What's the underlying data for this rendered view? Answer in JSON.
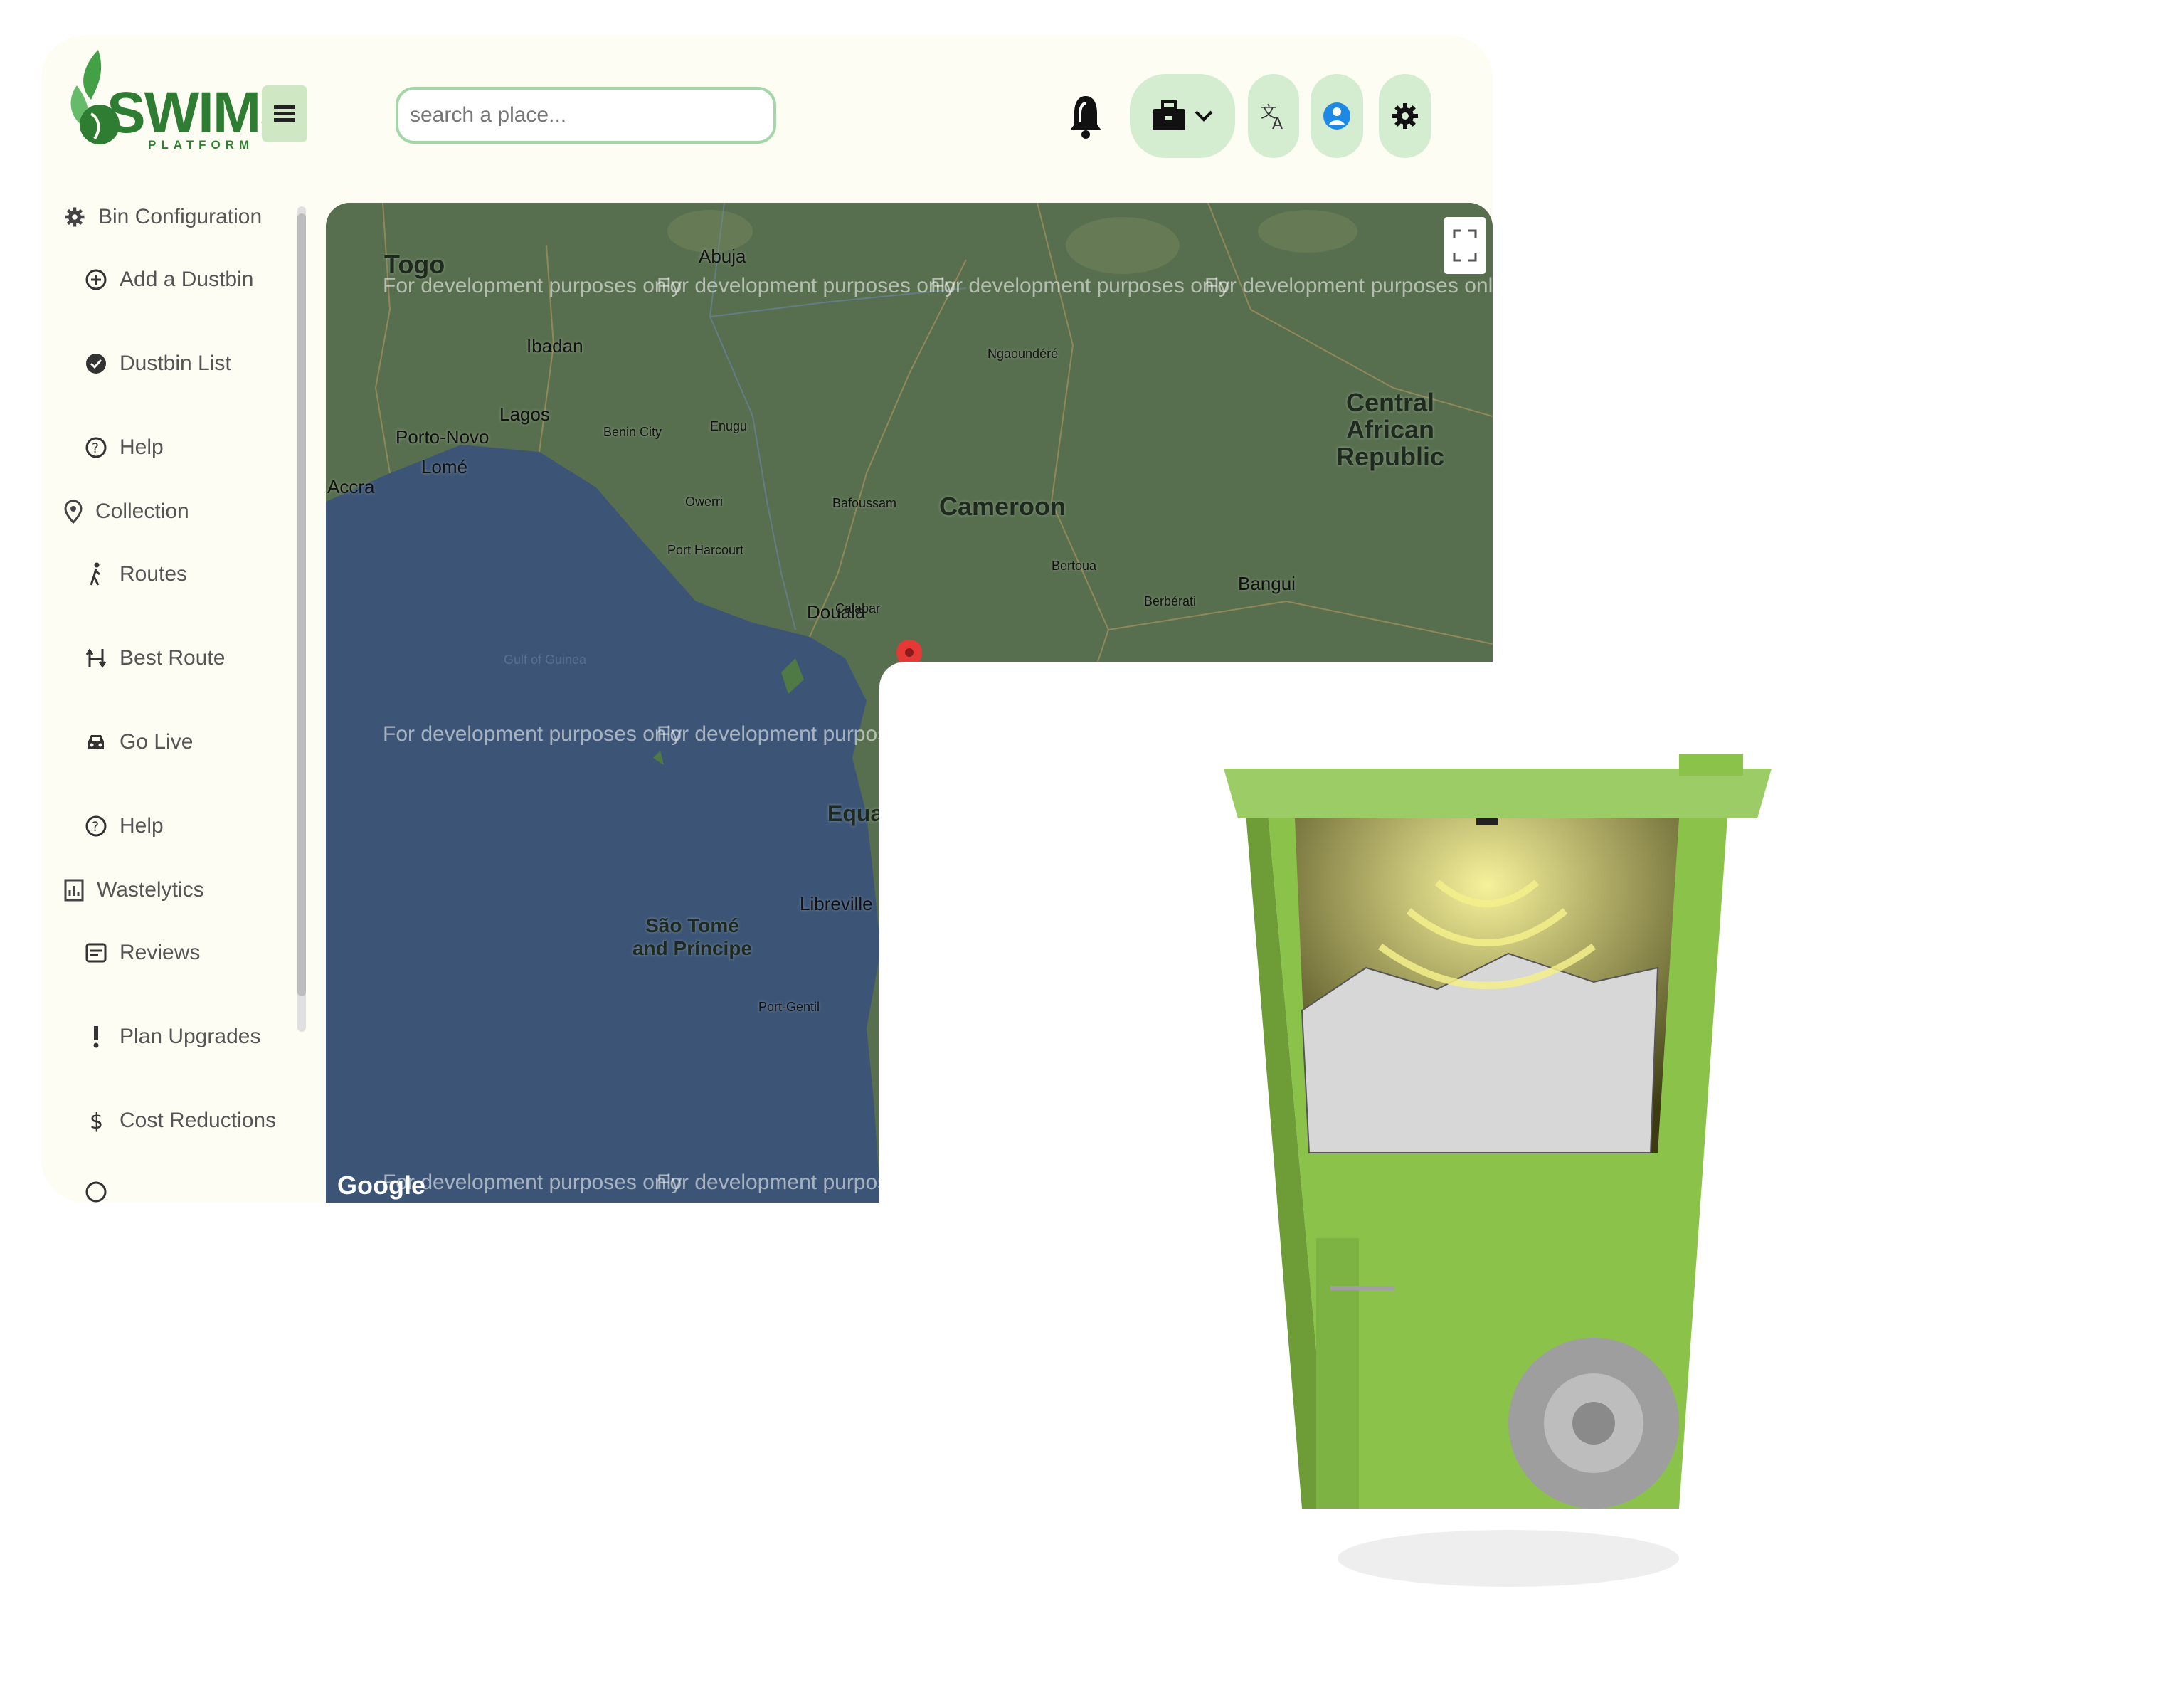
{
  "brand": {
    "name": "SWIMS",
    "tagline": "PLATFORM"
  },
  "header": {
    "search_placeholder": "search a place...",
    "icons": [
      "menu-icon",
      "bell-icon",
      "briefcase-icon",
      "chevron-down-icon",
      "translate-icon",
      "user-icon",
      "gear-icon"
    ]
  },
  "sidebar": {
    "sections": [
      {
        "label": "Bin Configuration",
        "icon": "gear-icon",
        "items": [
          {
            "label": "Add a Dustbin",
            "icon": "plus-circle-icon"
          },
          {
            "label": "Dustbin List",
            "icon": "list-circle-icon"
          },
          {
            "label": "Help",
            "icon": "help-icon"
          }
        ]
      },
      {
        "label": "Collection",
        "icon": "location-pin-icon",
        "items": [
          {
            "label": "Routes",
            "icon": "walk-icon"
          },
          {
            "label": "Best Route",
            "icon": "route-icon"
          },
          {
            "label": "Go Live",
            "icon": "car-icon"
          },
          {
            "label": "Help",
            "icon": "help-icon"
          }
        ]
      },
      {
        "label": "Wastelytics",
        "icon": "analytics-icon",
        "items": [
          {
            "label": "Reviews",
            "icon": "reviews-icon"
          },
          {
            "label": "Plan Upgrades",
            "icon": "exclamation-icon"
          },
          {
            "label": "Cost Reductions",
            "icon": "dollar-icon"
          }
        ]
      }
    ]
  },
  "map": {
    "watermark": "For development purposes only",
    "attribution": "Google",
    "countries": [
      "Togo",
      "Cameroon",
      "Central African Republic",
      "São Tomé and Príncipe",
      "Equatorial Guinea"
    ],
    "cities": [
      "Abuja",
      "Ibadan",
      "Lagos",
      "Porto-Novo",
      "Lomé",
      "Accra",
      "Douala",
      "Bangui",
      "Libreville",
      "Benin City",
      "Enugu",
      "Owerri",
      "Port Harcourt",
      "Calabar",
      "Bafoussam",
      "Ngaoundéré",
      "Bertoua",
      "Berbérati",
      "Port-Gentil",
      "Gulf of Guinea"
    ],
    "marker": "map-marker-icon"
  },
  "colors": {
    "brand_green": "#2e7d32",
    "accent": "#cfe8c3",
    "marker": "#e53935"
  }
}
